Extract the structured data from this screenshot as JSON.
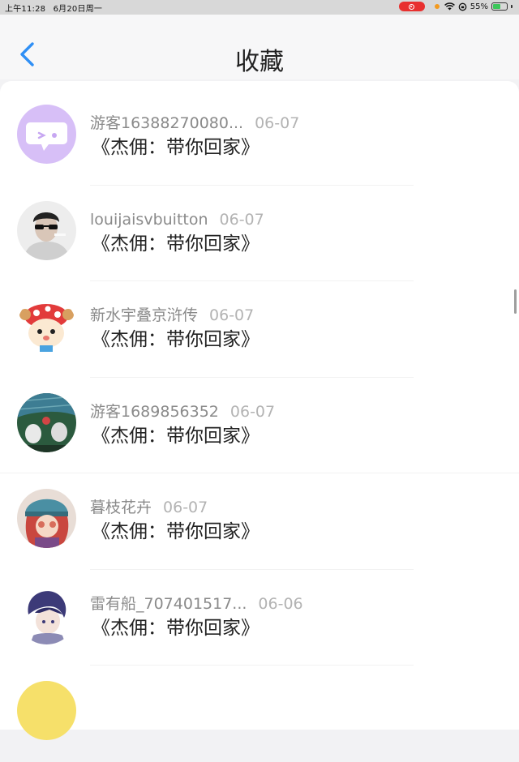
{
  "status_bar": {
    "time": "上午11:28",
    "date": "6月20日周一",
    "battery": "55%",
    "battery_level": 0.55
  },
  "header": {
    "title": "收藏",
    "back_icon": "chevron-left-icon"
  },
  "items": [
    {
      "name": "游客16388270080...",
      "date": "06-07",
      "content": "《杰佣：带你回家》"
    },
    {
      "name": "louijaisvbuitton",
      "date": "06-07",
      "content": "《杰佣：带你回家》"
    },
    {
      "name": "新水宇叠京浒传",
      "date": "06-07",
      "content": "《杰佣：带你回家》"
    },
    {
      "name": "游客1689856352",
      "date": "06-07",
      "content": "《杰佣：带你回家》"
    },
    {
      "name": "暮枝花卉",
      "date": "06-07",
      "content": "《杰佣：带你回家》"
    },
    {
      "name": "雷有船_707401517...",
      "date": "06-06",
      "content": "《杰佣：带你回家》"
    }
  ],
  "colors": {
    "accent": "#2f8ff5",
    "status_record": "#e8302f",
    "battery": "#3cc75a"
  }
}
